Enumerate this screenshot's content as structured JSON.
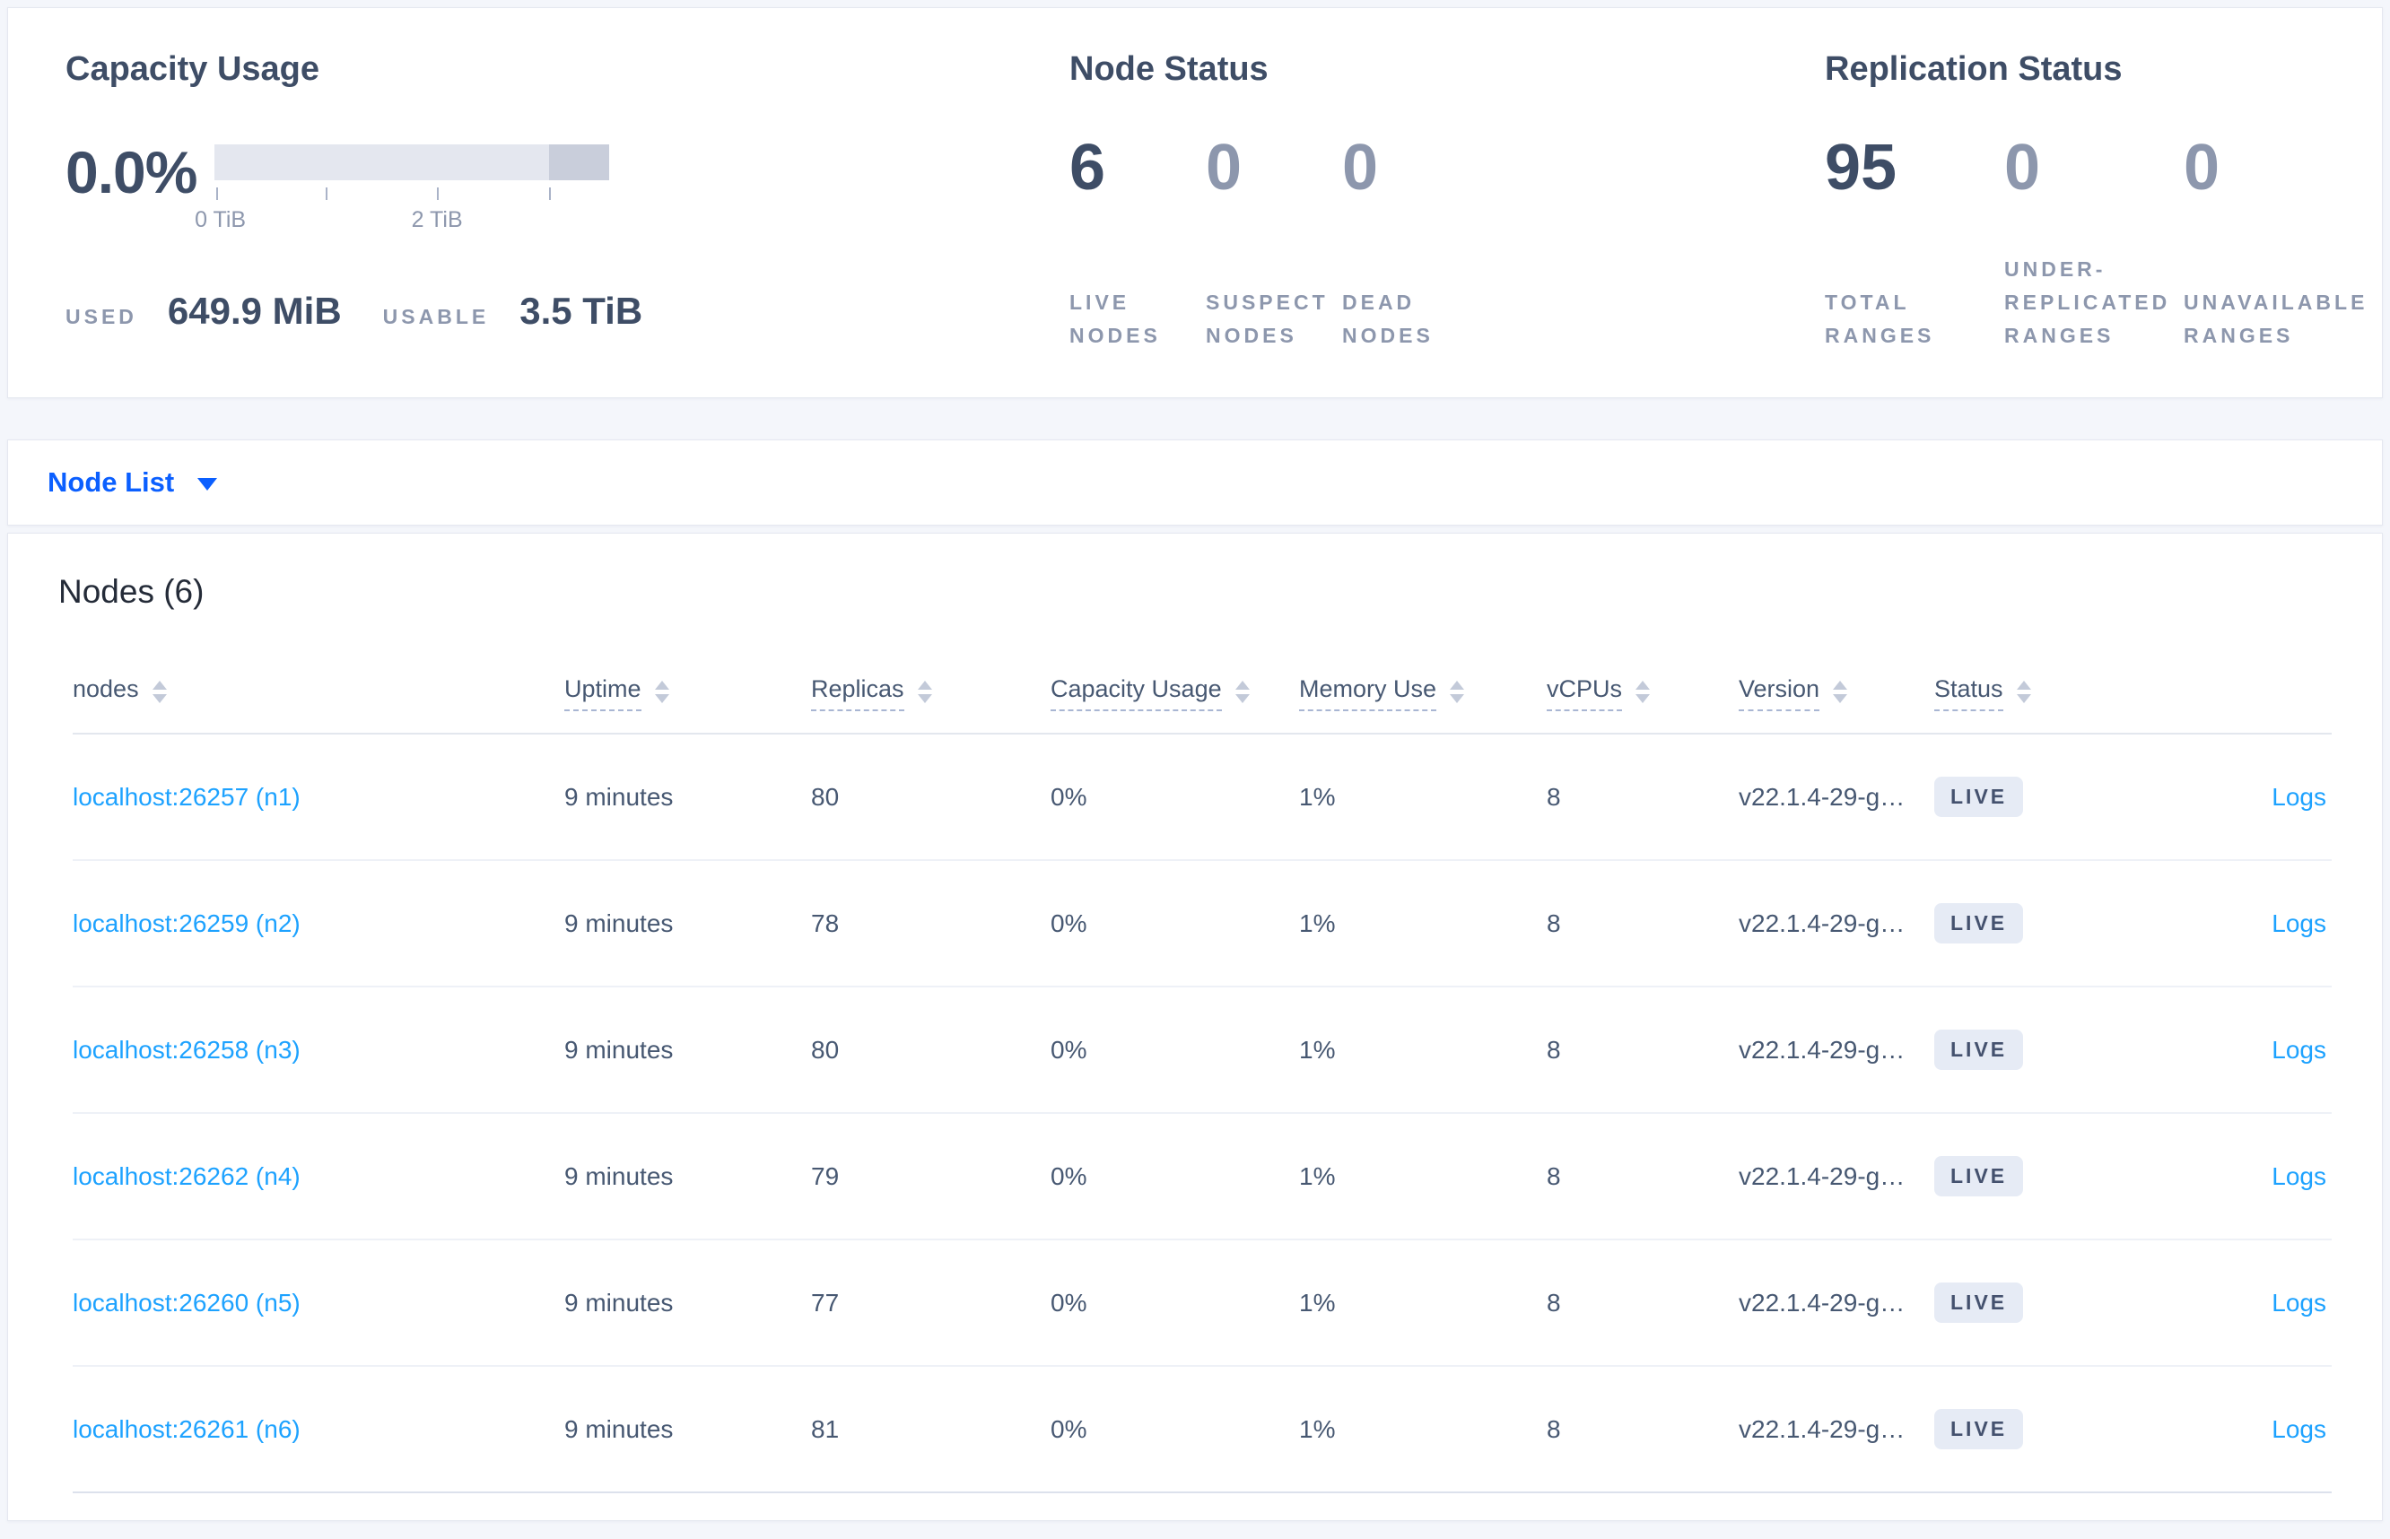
{
  "summary": {
    "capacity": {
      "title": "Capacity Usage",
      "percent": "0.0%",
      "tick_label_start": "0 TiB",
      "tick_label_mid": "2 TiB",
      "used_label": "USED",
      "used_value": "649.9 MiB",
      "usable_label": "USABLE",
      "usable_value": "3.5 TiB"
    },
    "node_status": {
      "title": "Node Status",
      "stats": [
        {
          "value": "6",
          "label": "LIVE NODES"
        },
        {
          "value": "0",
          "label": "SUSPECT NODES"
        },
        {
          "value": "0",
          "label": "DEAD NODES"
        }
      ]
    },
    "replication": {
      "title": "Replication Status",
      "stats": [
        {
          "value": "95",
          "label": "TOTAL RANGES"
        },
        {
          "value": "0",
          "label": "UNDER-REPLICATED RANGES"
        },
        {
          "value": "0",
          "label": "UNAVAILABLE RANGES"
        }
      ]
    }
  },
  "view_selector": {
    "label": "Node List"
  },
  "nodes_section": {
    "title": "Nodes (6)",
    "columns": [
      {
        "label": "nodes"
      },
      {
        "label": "Uptime"
      },
      {
        "label": "Replicas"
      },
      {
        "label": "Capacity Usage"
      },
      {
        "label": "Memory Use"
      },
      {
        "label": "vCPUs"
      },
      {
        "label": "Version"
      },
      {
        "label": "Status"
      }
    ],
    "rows": [
      {
        "address": "localhost:26257 (n1)",
        "uptime": "9 minutes",
        "replicas": "80",
        "capacity_usage": "0%",
        "memory_use": "1%",
        "vcpus": "8",
        "version": "v22.1.4-29-g…",
        "status": "LIVE",
        "logs_label": "Logs"
      },
      {
        "address": "localhost:26259 (n2)",
        "uptime": "9 minutes",
        "replicas": "78",
        "capacity_usage": "0%",
        "memory_use": "1%",
        "vcpus": "8",
        "version": "v22.1.4-29-g…",
        "status": "LIVE",
        "logs_label": "Logs"
      },
      {
        "address": "localhost:26258 (n3)",
        "uptime": "9 minutes",
        "replicas": "80",
        "capacity_usage": "0%",
        "memory_use": "1%",
        "vcpus": "8",
        "version": "v22.1.4-29-g…",
        "status": "LIVE",
        "logs_label": "Logs"
      },
      {
        "address": "localhost:26262 (n4)",
        "uptime": "9 minutes",
        "replicas": "79",
        "capacity_usage": "0%",
        "memory_use": "1%",
        "vcpus": "8",
        "version": "v22.1.4-29-g…",
        "status": "LIVE",
        "logs_label": "Logs"
      },
      {
        "address": "localhost:26260 (n5)",
        "uptime": "9 minutes",
        "replicas": "77",
        "capacity_usage": "0%",
        "memory_use": "1%",
        "vcpus": "8",
        "version": "v22.1.4-29-g…",
        "status": "LIVE",
        "logs_label": "Logs"
      },
      {
        "address": "localhost:26261 (n6)",
        "uptime": "9 minutes",
        "replicas": "81",
        "capacity_usage": "0%",
        "memory_use": "1%",
        "vcpus": "8",
        "version": "v22.1.4-29-g…",
        "status": "LIVE",
        "logs_label": "Logs"
      }
    ]
  },
  "colors": {
    "accent_blue": "#0b5fff",
    "link_blue": "#1da2ff",
    "dark_slate": "#3e4d66",
    "muted_slate": "#8d97ad",
    "badge_bg": "#e6ebf5",
    "badge_text": "#44516e",
    "bar_light": "#e4e7ef",
    "bar_dark": "#c9cedb"
  }
}
